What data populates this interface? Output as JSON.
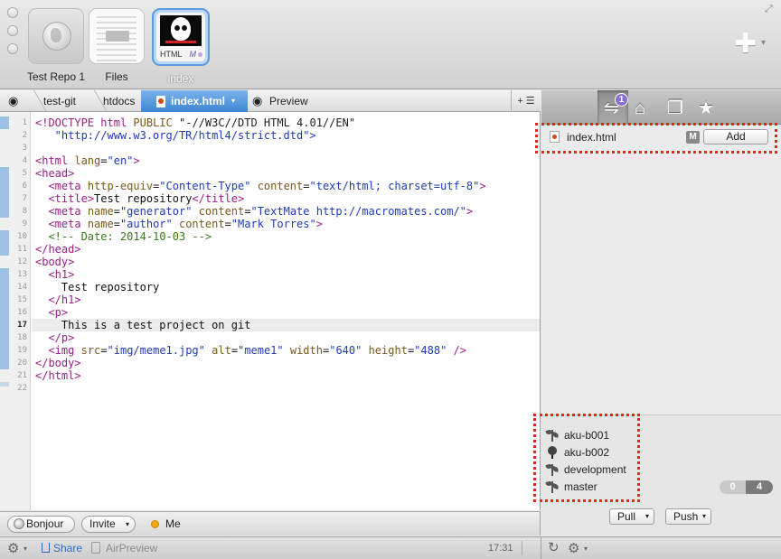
{
  "toolbar": {
    "sites": [
      {
        "label": "Test Repo 1",
        "icon": "globe-icon"
      },
      {
        "label": "Files",
        "icon": "document-icon"
      },
      {
        "label": "index",
        "thumb_label": "HTML",
        "badge": "M"
      }
    ],
    "add_icon": "plus-icon"
  },
  "pathbar": {
    "items": [
      "test-git",
      "htdocs"
    ],
    "active_file": "index.html",
    "preview": "Preview"
  },
  "editor": {
    "current_line": 17,
    "lines": [
      "<!DOCTYPE html PUBLIC \"-//W3C//DTD HTML 4.01//EN\"",
      "   \"http://www.w3.org/TR/html4/strict.dtd\">",
      "",
      "<html lang=\"en\">",
      "<head>",
      "  <meta http-equiv=\"Content-Type\" content=\"text/html; charset=utf-8\">",
      "  <title>Test repository</title>",
      "  <meta name=\"generator\" content=\"TextMate http://macromates.com/\">",
      "  <meta name=\"author\" content=\"Mark Torres\">",
      "  <!-- Date: 2014-10-03 -->",
      "</head>",
      "<body>",
      "  <h1>",
      "    Test repository",
      "  </h1>",
      "  <p>",
      "    This is a test project on git",
      "  </p>",
      "  <img src=\"img/meme1.jpg\" alt=\"meme1\" width=\"640\" height=\"488\" />",
      "</body>",
      "</html>",
      ""
    ]
  },
  "statusbar": {
    "bonjour": "Bonjour",
    "invite": "Invite",
    "me": "Me",
    "share": "Share",
    "airpreview": "AirPreview",
    "time": "17:31"
  },
  "git_panel": {
    "badge_count": "1",
    "tabs": [
      "changes-icon",
      "home-icon",
      "files-icon",
      "starred-icon"
    ],
    "changes": [
      {
        "file": "index.html",
        "status": "M",
        "action": "Add"
      }
    ],
    "branches": [
      "aku-b001",
      "aku-b002",
      "development",
      "master"
    ],
    "current_branch": "aku-b002",
    "ahead": "0",
    "behind": "4",
    "pull_label": "Pull",
    "push_label": "Push"
  },
  "colors": {
    "accent": "#3e86d3",
    "highlight": "#e0281a",
    "badge": "#8b6fd1"
  }
}
